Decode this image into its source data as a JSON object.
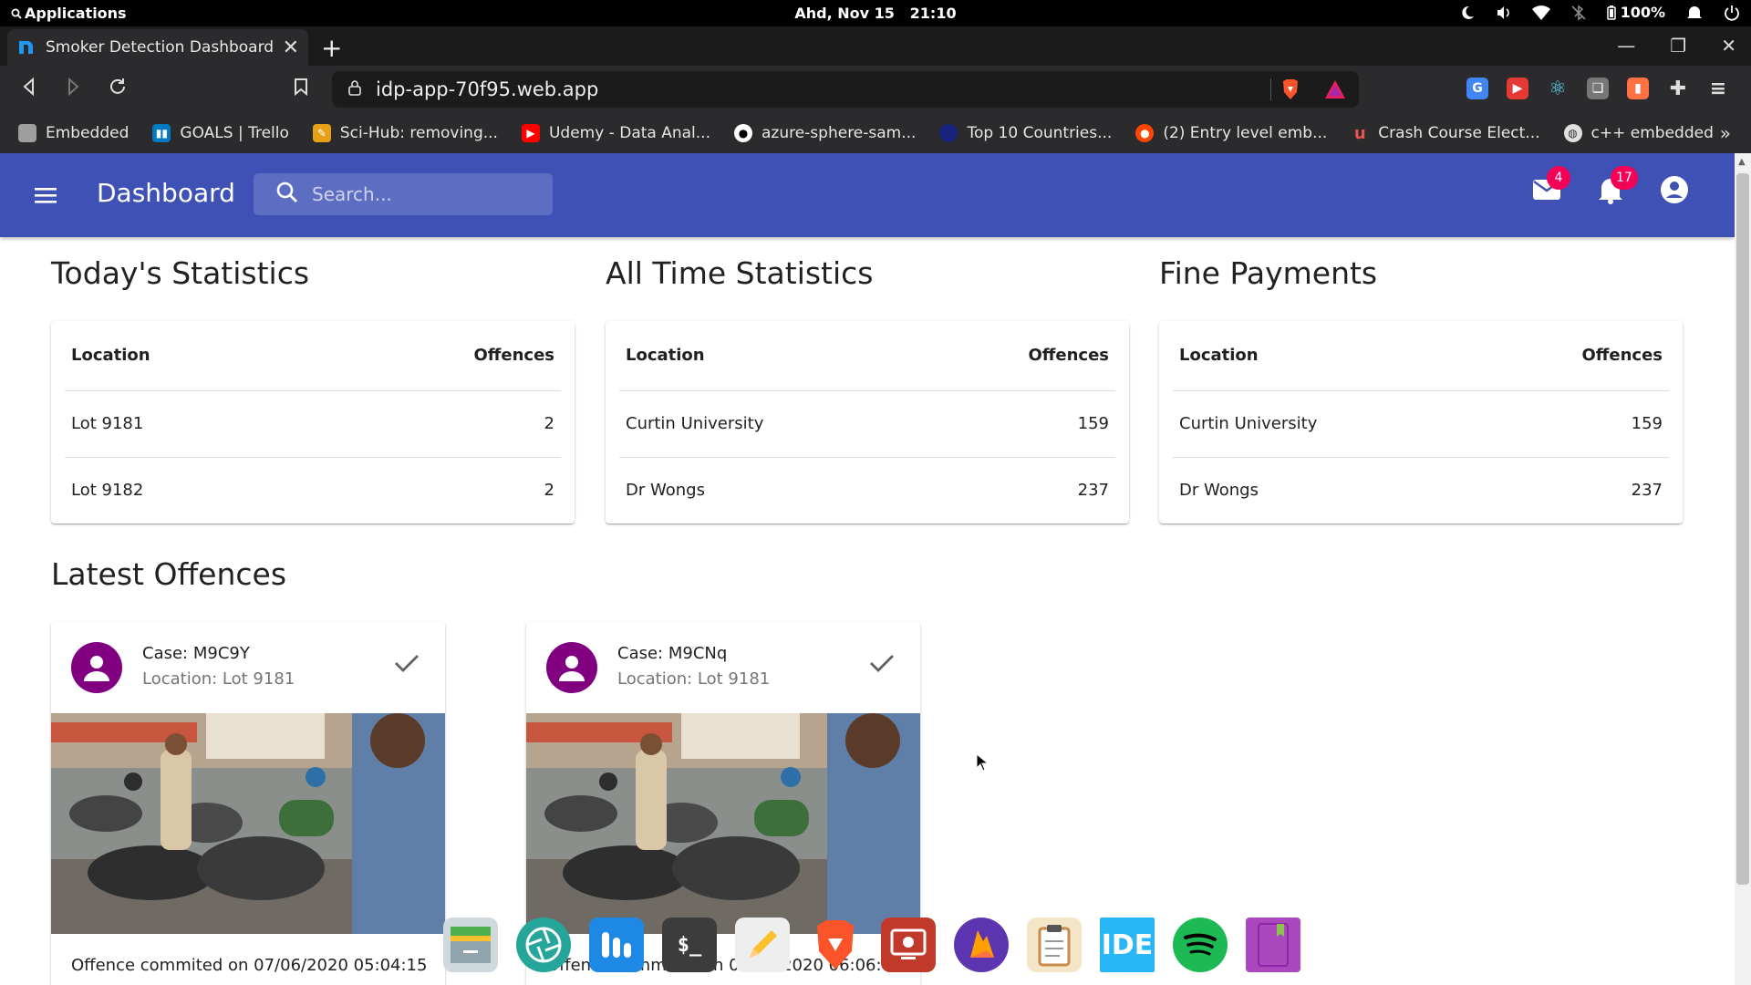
{
  "system_bar": {
    "applications_label": "Applications",
    "date": "Ahd, Nov 15",
    "time": "21:10",
    "battery": "100%"
  },
  "browser": {
    "tab_title": "Smoker Detection Dashboard",
    "url": "idp-app-70f95.web.app",
    "bookmarks": [
      {
        "label": "Embedded",
        "icon": "folder-icon",
        "color": "#9e9e9e"
      },
      {
        "label": "GOALS | Trello",
        "icon": "trello-icon",
        "color": "#0079bf"
      },
      {
        "label": "Sci-Hub: removing...",
        "icon": "scihub-icon",
        "color": "#e6a117"
      },
      {
        "label": "Udemy - Data Anal...",
        "icon": "youtube-icon",
        "color": "#ff0000"
      },
      {
        "label": "azure-sphere-sam...",
        "icon": "github-icon",
        "color": "#ffffff"
      },
      {
        "label": "Top 10 Countries...",
        "icon": "globe-dark-icon",
        "color": "#1a237e"
      },
      {
        "label": "(2) Entry level emb...",
        "icon": "reddit-icon",
        "color": "#ff4500"
      },
      {
        "label": "Crash Course Elect...",
        "icon": "udemy-icon",
        "color": "#ec5252"
      },
      {
        "label": "c++ embedded",
        "icon": "globe-icon",
        "color": "#e0e0e0"
      }
    ]
  },
  "app": {
    "title": "Dashboard",
    "search_placeholder": "Search...",
    "mail_badge": "4",
    "notification_badge": "17",
    "accent": "#3f51b5"
  },
  "stats": [
    {
      "title": "Today's Statistics",
      "col_location": "Location",
      "col_offences": "Offences",
      "rows": [
        {
          "location": "Lot 9181",
          "offences": "2"
        },
        {
          "location": "Lot 9182",
          "offences": "2"
        }
      ]
    },
    {
      "title": "All Time Statistics",
      "col_location": "Location",
      "col_offences": "Offences",
      "rows": [
        {
          "location": "Curtin University",
          "offences": "159"
        },
        {
          "location": "Dr Wongs",
          "offences": "237"
        }
      ]
    },
    {
      "title": "Fine Payments",
      "col_location": "Location",
      "col_offences": "Offences",
      "rows": [
        {
          "location": "Curtin University",
          "offences": "159"
        },
        {
          "location": "Dr Wongs",
          "offences": "237"
        }
      ]
    }
  ],
  "latest": {
    "title": "Latest Offences",
    "cards": [
      {
        "case": "Case: M9C9Y",
        "location": "Location: Lot 9181",
        "committed": "Offence commited on 07/06/2020 05:04:15"
      },
      {
        "case": "Case: M9CNq",
        "location": "Location: Lot 9181",
        "committed": "Offence commited on 07/06/2020 06:06:40"
      }
    ]
  },
  "dock_apps": [
    {
      "icon": "files-icon",
      "label": "",
      "color": "#cfd8dc"
    },
    {
      "icon": "aperture-icon",
      "label": "",
      "color": "#26a69a"
    },
    {
      "icon": "dash-icon",
      "label": "",
      "color": "#1e88e5"
    },
    {
      "icon": "terminal-icon",
      "label": "$_",
      "color": "#3c3c3c"
    },
    {
      "icon": "text-editor-icon",
      "label": "",
      "color": "#eeeeee"
    },
    {
      "icon": "brave-icon",
      "label": "",
      "color": "#fb542b"
    },
    {
      "icon": "screen-recorder-icon",
      "label": "",
      "color": "#c0392b"
    },
    {
      "icon": "firebase-icon",
      "label": "",
      "color": "#5e35b1"
    },
    {
      "icon": "clipboard-icon",
      "label": "",
      "color": "#f5e6c8"
    },
    {
      "icon": "ide-icon",
      "label": "IDE",
      "color": "#29b6f6"
    },
    {
      "icon": "spotify-icon",
      "label": "",
      "color": "#1db954"
    },
    {
      "icon": "notebook-icon",
      "label": "",
      "color": "#ab47bc"
    }
  ]
}
